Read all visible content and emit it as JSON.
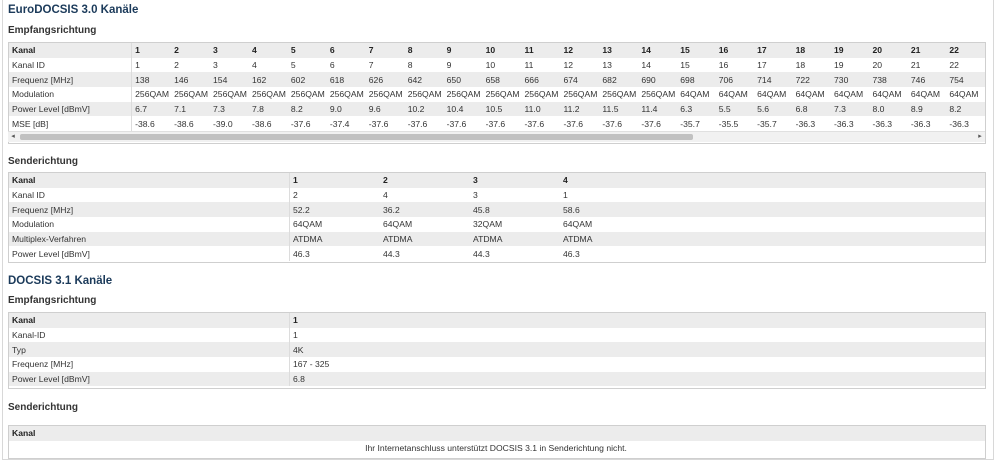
{
  "docsis30": {
    "title": "EuroDOCSIS 3.0 Kanäle",
    "downstream": {
      "title": "Empfangsrichtung",
      "columns": [
        "1",
        "2",
        "3",
        "4",
        "5",
        "6",
        "7",
        "8",
        "9",
        "10",
        "11",
        "12",
        "13",
        "14",
        "15",
        "16",
        "17",
        "18",
        "19",
        "20",
        "21",
        "22"
      ],
      "rows": [
        {
          "label": "Kanal",
          "values": [
            "1",
            "2",
            "3",
            "4",
            "5",
            "6",
            "7",
            "8",
            "9",
            "10",
            "11",
            "12",
            "13",
            "14",
            "15",
            "16",
            "17",
            "18",
            "19",
            "20",
            "21",
            "22"
          ]
        },
        {
          "label": "Kanal ID",
          "values": [
            "1",
            "2",
            "3",
            "4",
            "5",
            "6",
            "7",
            "8",
            "9",
            "10",
            "11",
            "12",
            "13",
            "14",
            "15",
            "16",
            "17",
            "18",
            "19",
            "20",
            "21",
            "22"
          ]
        },
        {
          "label": "Frequenz [MHz]",
          "values": [
            "138",
            "146",
            "154",
            "162",
            "602",
            "618",
            "626",
            "642",
            "650",
            "658",
            "666",
            "674",
            "682",
            "690",
            "698",
            "706",
            "714",
            "722",
            "730",
            "738",
            "746",
            "754"
          ]
        },
        {
          "label": "Modulation",
          "values": [
            "256QAM",
            "256QAM",
            "256QAM",
            "256QAM",
            "256QAM",
            "256QAM",
            "256QAM",
            "256QAM",
            "256QAM",
            "256QAM",
            "256QAM",
            "256QAM",
            "256QAM",
            "256QAM",
            "64QAM",
            "64QAM",
            "64QAM",
            "64QAM",
            "64QAM",
            "64QAM",
            "64QAM",
            "64QAM"
          ]
        },
        {
          "label": "Power Level [dBmV]",
          "values": [
            "6.7",
            "7.1",
            "7.3",
            "7.8",
            "8.2",
            "9.0",
            "9.6",
            "10.2",
            "10.4",
            "10.5",
            "11.0",
            "11.2",
            "11.5",
            "11.4",
            "6.3",
            "5.5",
            "5.6",
            "6.8",
            "7.3",
            "8.0",
            "8.9",
            "8.2"
          ]
        },
        {
          "label": "MSE [dB]",
          "values": [
            "-38.6",
            "-38.6",
            "-39.0",
            "-38.6",
            "-37.6",
            "-37.4",
            "-37.6",
            "-37.6",
            "-37.6",
            "-37.6",
            "-37.6",
            "-37.6",
            "-37.6",
            "-37.6",
            "-35.7",
            "-35.5",
            "-35.7",
            "-36.3",
            "-36.3",
            "-36.3",
            "-36.3",
            "-36.3"
          ]
        }
      ]
    },
    "upstream": {
      "title": "Senderichtung",
      "rows": [
        {
          "label": "Kanal",
          "values": [
            "1",
            "2",
            "3",
            "4"
          ]
        },
        {
          "label": "Kanal ID",
          "values": [
            "2",
            "4",
            "3",
            "1"
          ]
        },
        {
          "label": "Frequenz [MHz]",
          "values": [
            "52.2",
            "36.2",
            "45.8",
            "58.6"
          ]
        },
        {
          "label": "Modulation",
          "values": [
            "64QAM",
            "64QAM",
            "32QAM",
            "64QAM"
          ]
        },
        {
          "label": "Multiplex-Verfahren",
          "values": [
            "ATDMA",
            "ATDMA",
            "ATDMA",
            "ATDMA"
          ]
        },
        {
          "label": "Power Level [dBmV]",
          "values": [
            "46.3",
            "44.3",
            "44.3",
            "46.3"
          ]
        }
      ]
    }
  },
  "docsis31": {
    "title": "DOCSIS 3.1 Kanäle",
    "downstream": {
      "title": "Empfangsrichtung",
      "rows": [
        {
          "label": "Kanal",
          "values": [
            "1"
          ]
        },
        {
          "label": "Kanal-ID",
          "values": [
            "1"
          ]
        },
        {
          "label": "Typ",
          "values": [
            "4K"
          ]
        },
        {
          "label": "Frequenz [MHz]",
          "values": [
            "167 - 325"
          ]
        },
        {
          "label": "Power Level [dBmV]",
          "values": [
            "6.8"
          ]
        }
      ]
    },
    "upstream": {
      "title": "Senderichtung",
      "header": "Kanal",
      "message": "Ihr Internetanschluss unterstützt DOCSIS 3.1 in Senderichtung nicht."
    }
  },
  "scroll": {
    "left_arrow": "◂",
    "right_arrow": "▸"
  }
}
